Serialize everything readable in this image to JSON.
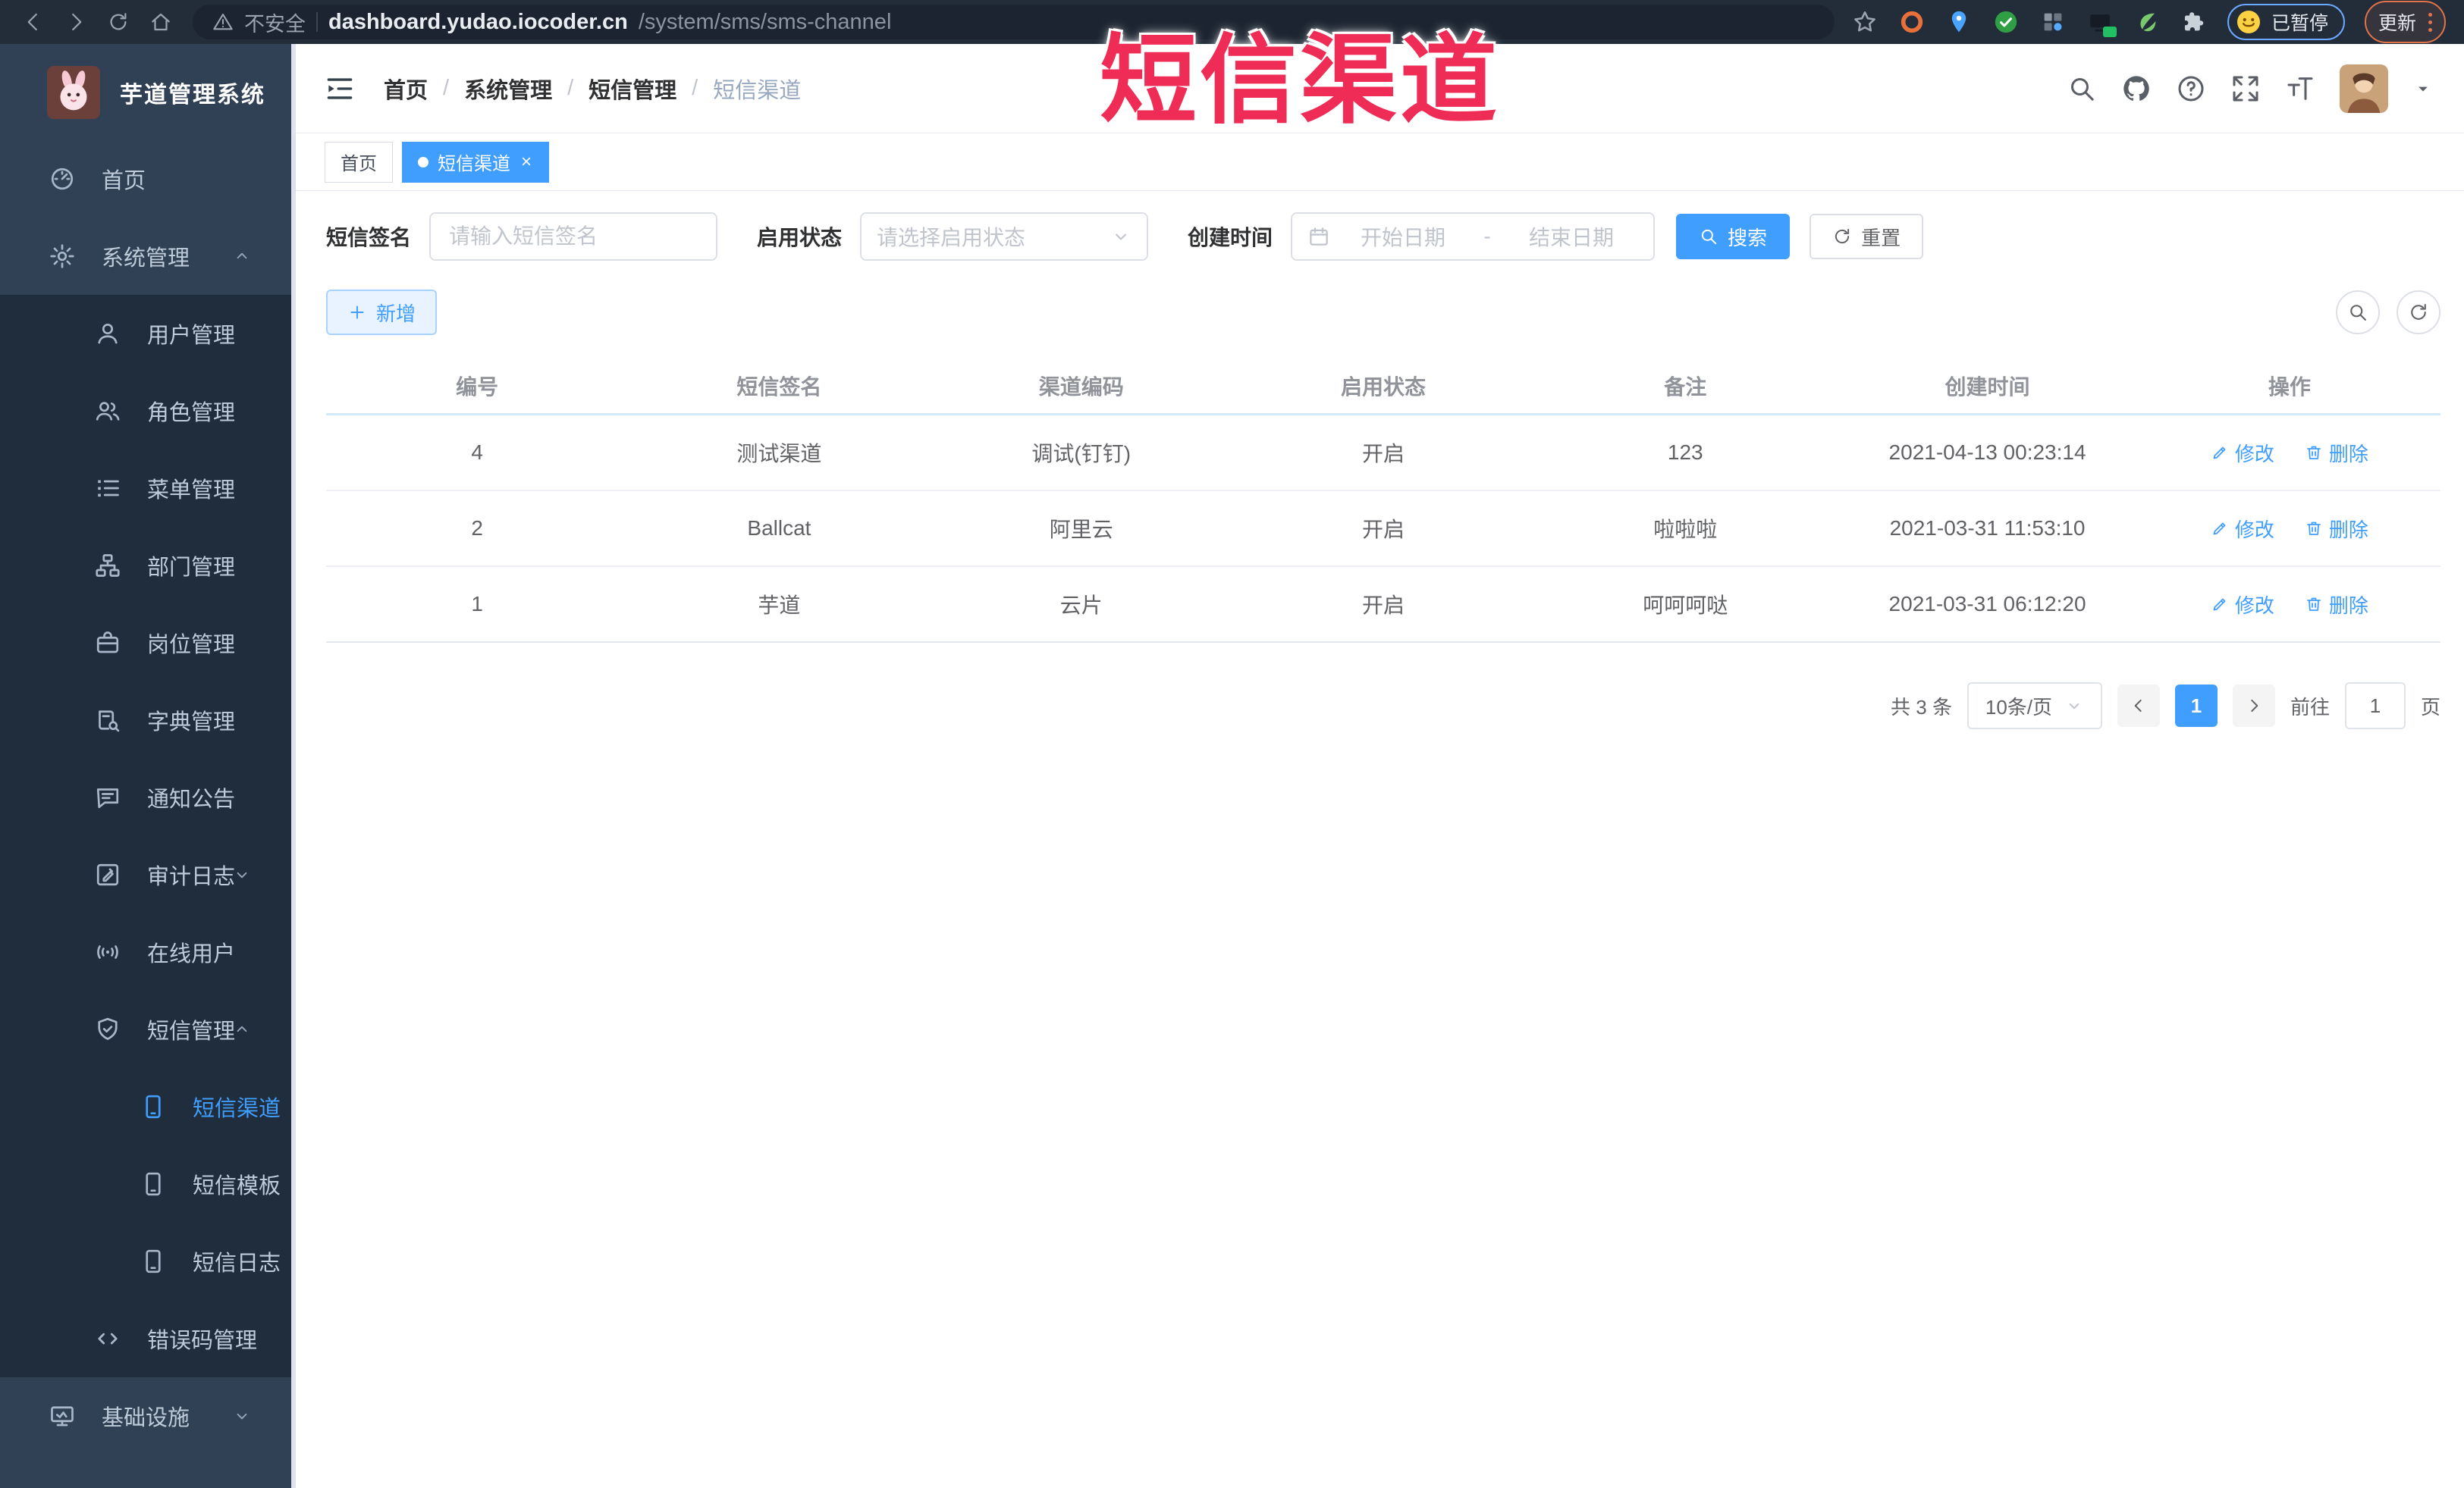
{
  "browser": {
    "security_label": "不安全",
    "url_host": "dashboard.yudao.iocoder.cn",
    "url_path": "/system/sms/sms-channel",
    "paused_badge": "已暂停",
    "update_button": "更新"
  },
  "watermark": "短信渠道",
  "sidebar": {
    "app_title": "芋道管理系统",
    "items": [
      {
        "label": "首页"
      },
      {
        "label": "系统管理"
      },
      {
        "label": "用户管理"
      },
      {
        "label": "角色管理"
      },
      {
        "label": "菜单管理"
      },
      {
        "label": "部门管理"
      },
      {
        "label": "岗位管理"
      },
      {
        "label": "字典管理"
      },
      {
        "label": "通知公告"
      },
      {
        "label": "审计日志"
      },
      {
        "label": "在线用户"
      },
      {
        "label": "短信管理"
      },
      {
        "label": "短信渠道",
        "active": true
      },
      {
        "label": "短信模板"
      },
      {
        "label": "短信日志"
      },
      {
        "label": "错误码管理"
      },
      {
        "label": "基础设施"
      }
    ]
  },
  "header": {
    "breadcrumb": [
      "首页",
      "系统管理",
      "短信管理",
      "短信渠道"
    ],
    "separator": "/"
  },
  "tags": [
    {
      "label": "首页"
    },
    {
      "label": "短信渠道",
      "active": true,
      "close": "×"
    }
  ],
  "filters": {
    "sign_label": "短信签名",
    "sign_placeholder": "请输入短信签名",
    "status_label": "启用状态",
    "status_placeholder": "请选择启用状态",
    "time_label": "创建时间",
    "start_placeholder": "开始日期",
    "range_separator": "-",
    "end_placeholder": "结束日期",
    "search_button": "搜索",
    "reset_button": "重置"
  },
  "toolbar": {
    "add_button": "新增"
  },
  "table": {
    "columns": [
      "编号",
      "短信签名",
      "渠道编码",
      "启用状态",
      "备注",
      "创建时间",
      "操作"
    ],
    "rows": [
      {
        "id": "4",
        "sign": "测试渠道",
        "code": "调试(钉钉)",
        "status": "开启",
        "remark": "123",
        "created": "2021-04-13 00:23:14"
      },
      {
        "id": "2",
        "sign": "Ballcat",
        "code": "阿里云",
        "status": "开启",
        "remark": "啦啦啦",
        "created": "2021-03-31 11:53:10"
      },
      {
        "id": "1",
        "sign": "芋道",
        "code": "云片",
        "status": "开启",
        "remark": "呵呵呵哒",
        "created": "2021-03-31 06:12:20"
      }
    ],
    "edit_action": "修改",
    "delete_action": "删除"
  },
  "pagination": {
    "total": "共 3 条",
    "page_size": "10条/页",
    "current_page": "1",
    "goto_label": "前往",
    "goto_value": "1",
    "page_unit": "页"
  },
  "colors": {
    "accent": "#409eff",
    "watermark_red": "#ee2c55",
    "sidebar_bg": "#304156",
    "submenu_bg": "#1f2d3d"
  }
}
